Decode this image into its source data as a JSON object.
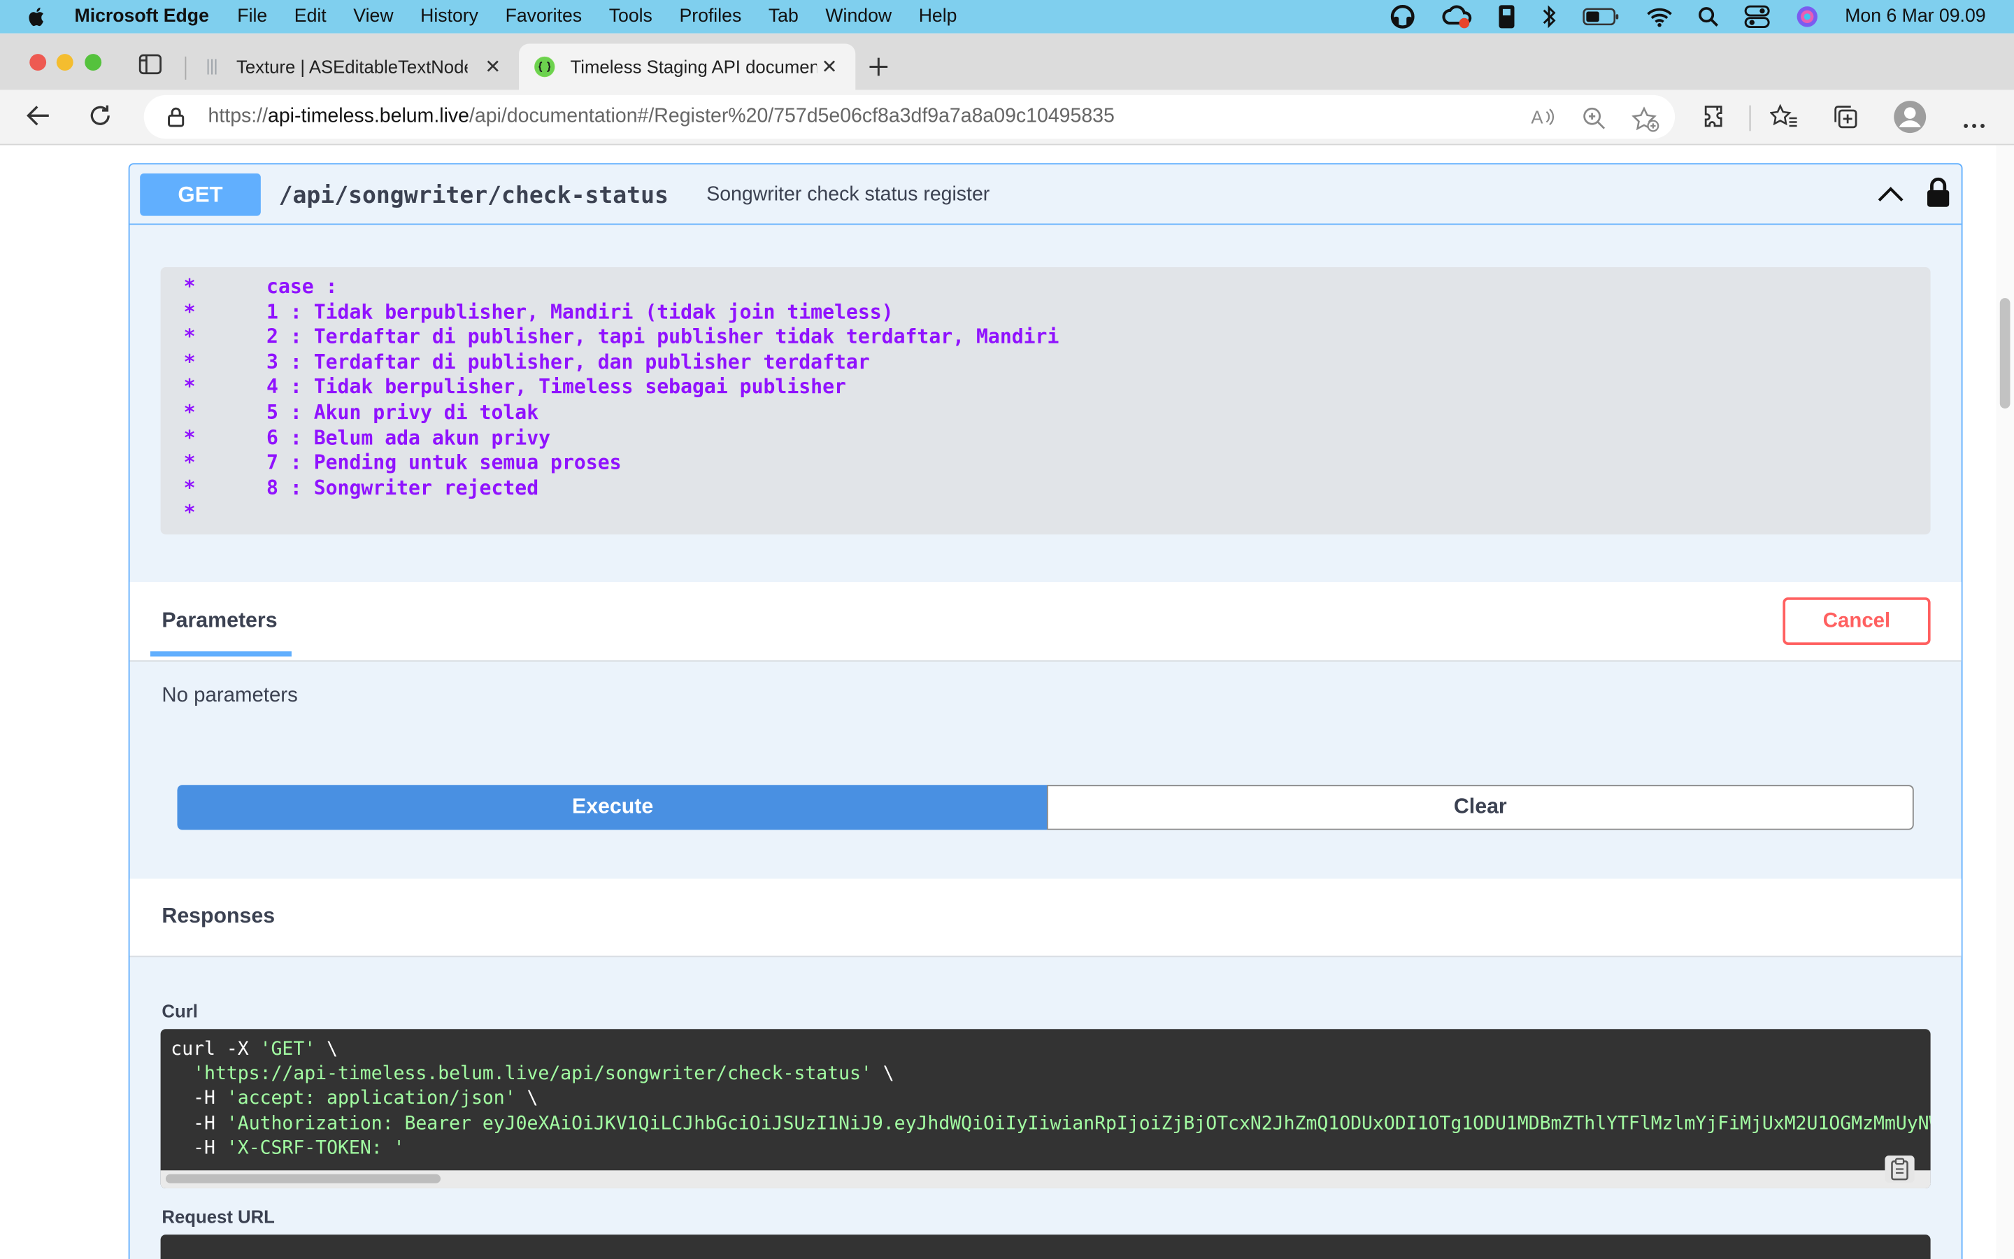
{
  "menubar": {
    "app_name": "Microsoft Edge",
    "items": [
      "File",
      "Edit",
      "View",
      "History",
      "Favorites",
      "Tools",
      "Profiles",
      "Tab",
      "Window",
      "Help"
    ],
    "clock": "Mon 6 Mar  09.09"
  },
  "tabs": [
    {
      "label": "Texture | ASEditableTextNode",
      "active": false
    },
    {
      "label": "Timeless Staging API documen",
      "active": true
    }
  ],
  "address": {
    "prefix": "https://",
    "host": "api-timeless.belum.live",
    "path": "/api/documentation#/Register%20/757d5e06cf8a3df9a7a8a09c10495835"
  },
  "operation": {
    "method": "GET",
    "path": "/api/songwriter/check-status",
    "summary": "Songwriter check status register",
    "description": "*      case :\n*      1 : Tidak berpublisher, Mandiri (tidak join timeless)\n*      2 : Terdaftar di publisher, tapi publisher tidak terdaftar, Mandiri\n*      3 : Terdaftar di publisher, dan publisher terdaftar\n*      4 : Tidak berpulisher, Timeless sebagai publisher\n*      5 : Akun privy di tolak\n*      6 : Belum ada akun privy\n*      7 : Pending untuk semua proses\n*      8 : Songwriter rejected\n*"
  },
  "parameters": {
    "title": "Parameters",
    "cancel_label": "Cancel",
    "empty_text": "No parameters"
  },
  "actions": {
    "execute_label": "Execute",
    "clear_label": "Clear"
  },
  "responses": {
    "title": "Responses",
    "curl_label": "Curl",
    "curl_lines": [
      {
        "plain": "curl -X ",
        "str": "'GET'",
        "tail": " \\"
      },
      {
        "plain": "  ",
        "str": "'https://api-timeless.belum.live/api/songwriter/check-status'",
        "tail": " \\"
      },
      {
        "plain": "  -H ",
        "str": "'accept: application/json'",
        "tail": " \\"
      },
      {
        "plain": "  -H ",
        "str": "'Authorization: Bearer eyJ0eXAiOiJKV1QiLCJhbGciOiJSUzI1NiJ9.eyJhdWQiOiIyIiwianRpIjoiZjBjOTcxN2JhZmQ1ODUxODI1OTg1ODU1MDBmZThlYTFlMzlmYjFiMjUxM2U1OGMzMmUyNW",
        "tail": ""
      },
      {
        "plain": "  -H ",
        "str": "'X-CSRF-TOKEN: '",
        "tail": ""
      }
    ],
    "request_url_label": "Request URL"
  },
  "colors": {
    "get_blue": "#61affe",
    "execute_blue": "#4990e2",
    "cancel_red": "#ff6060",
    "description_purple": "#9012fe",
    "curl_string_green": "#a2fca2"
  }
}
